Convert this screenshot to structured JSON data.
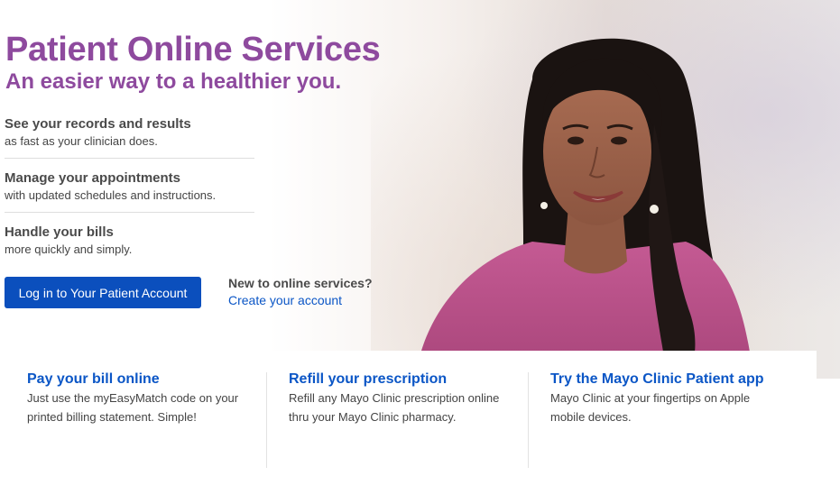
{
  "header": {
    "title": "Patient Online Services",
    "subtitle": "An easier way to a healthier you."
  },
  "features": [
    {
      "title": "See your records and results",
      "desc": "as fast as your clinician does."
    },
    {
      "title": "Manage your appointments",
      "desc": "with updated schedules and instructions."
    },
    {
      "title": "Handle your bills",
      "desc": "more quickly and simply."
    }
  ],
  "login": {
    "button_label": "Log in to Your Patient Account",
    "new_label": "New to online services?",
    "create_link": "Create your account"
  },
  "cards": [
    {
      "title": "Pay your bill online",
      "desc": "Just use the myEasyMatch code on your printed billing statement. Simple!"
    },
    {
      "title": "Refill your prescription",
      "desc": "Refill any Mayo Clinic prescription online thru your Mayo Clinic pharmacy."
    },
    {
      "title": "Try the Mayo Clinic Patient app",
      "desc": "Mayo Clinic at your fingertips on Apple mobile devices."
    }
  ],
  "colors": {
    "brand_purple": "#8e4a9e",
    "button_blue": "#0b4fbd",
    "link_blue": "#0b56c6"
  }
}
